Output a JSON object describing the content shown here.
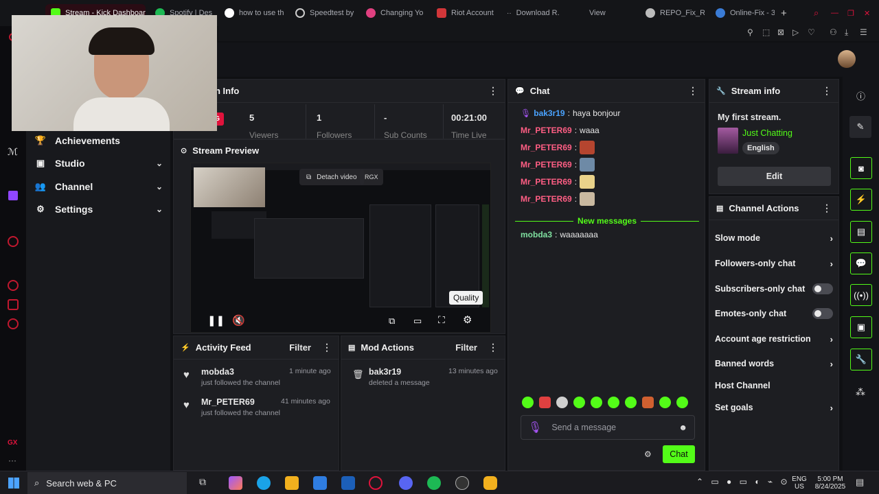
{
  "browser": {
    "tabs": [
      {
        "label": "Stream - Kick Dashboar",
        "active": true
      },
      {
        "label": "Spotify | Des"
      },
      {
        "label": "how to use th"
      },
      {
        "label": "Speedtest by"
      },
      {
        "label": "Changing Yo"
      },
      {
        "label": "Riot Account"
      },
      {
        "label": "Download R."
      },
      {
        "label": "View"
      },
      {
        "label": "REPO_Fix_Re"
      },
      {
        "label": "Online-Fix - 3"
      }
    ]
  },
  "nav": {
    "items": [
      {
        "label": "Achievements",
        "icon": "trophy-icon"
      },
      {
        "label": "Studio",
        "icon": "studio-icon"
      },
      {
        "label": "Channel",
        "icon": "channel-icon"
      },
      {
        "label": "Settings",
        "icon": "gear-icon"
      }
    ]
  },
  "session": {
    "title": "n Info",
    "badge": "NG",
    "stats": [
      {
        "value": "5",
        "label": "Viewers"
      },
      {
        "value": "1",
        "label": "Followers"
      },
      {
        "value": "-",
        "label": "Sub Counts"
      },
      {
        "value": "00:21:00",
        "label": "Time Live"
      }
    ]
  },
  "preview": {
    "title": "Stream Preview",
    "detach_label": "Detach video",
    "rgx_label": "RGX",
    "tooltip": "Quality"
  },
  "activity": {
    "title": "Activity Feed",
    "filter": "Filter",
    "items": [
      {
        "user": "mobda3",
        "text": "just followed the channel",
        "time": "1 minute ago"
      },
      {
        "user": "Mr_PETER69",
        "text": "just followed the channel",
        "time": "41 minutes ago"
      }
    ]
  },
  "mod": {
    "title": "Mod Actions",
    "filter": "Filter",
    "items": [
      {
        "user": "bak3r19",
        "text": "deleted a message",
        "time": "13 minutes ago"
      }
    ]
  },
  "chat": {
    "title": "Chat",
    "messages": [
      {
        "user": "bak3r19",
        "text": "haya bonjour",
        "color": "#4aa3ff"
      },
      {
        "user": "Mr_PETER69",
        "text": "waaa",
        "color": "#ff5e84"
      },
      {
        "user": "Mr_PETER69",
        "text": "",
        "color": "#ff5e84"
      },
      {
        "user": "Mr_PETER69",
        "text": "",
        "color": "#ff5e84"
      },
      {
        "user": "Mr_PETER69",
        "text": "",
        "color": "#ff5e84"
      },
      {
        "user": "Mr_PETER69",
        "text": "",
        "color": "#ff5e84"
      }
    ],
    "new_messages": "New messages",
    "after": {
      "user": "mobda3",
      "text": "waaaaaaa",
      "color": "#7fe0a0"
    },
    "placeholder": "Send a message",
    "send": "Chat"
  },
  "stream_info": {
    "title": "Stream info",
    "stream_title": "My first stream.",
    "category": "Just Chatting",
    "language": "English",
    "edit": "Edit"
  },
  "channel_actions": {
    "title": "Channel Actions",
    "items": [
      {
        "label": "Slow mode",
        "control": "chevron"
      },
      {
        "label": "Followers-only chat",
        "control": "chevron"
      },
      {
        "label": "Subscribers-only chat",
        "control": "toggle"
      },
      {
        "label": "Emotes-only chat",
        "control": "toggle"
      },
      {
        "label": "Account age restriction",
        "control": "chevron"
      },
      {
        "label": "Banned words",
        "control": "chevron"
      },
      {
        "label": "Host Channel",
        "control": "none"
      },
      {
        "label": "Set goals",
        "control": "chevron"
      }
    ]
  },
  "taskbar": {
    "search": "Search web & PC",
    "lang1": "ENG",
    "lang2": "US",
    "time": "5:00 PM",
    "date": "8/24/2025"
  },
  "colors": {
    "accent": "#53fc18",
    "brand_red": "#e0133c",
    "panel": "#1d1e22"
  }
}
